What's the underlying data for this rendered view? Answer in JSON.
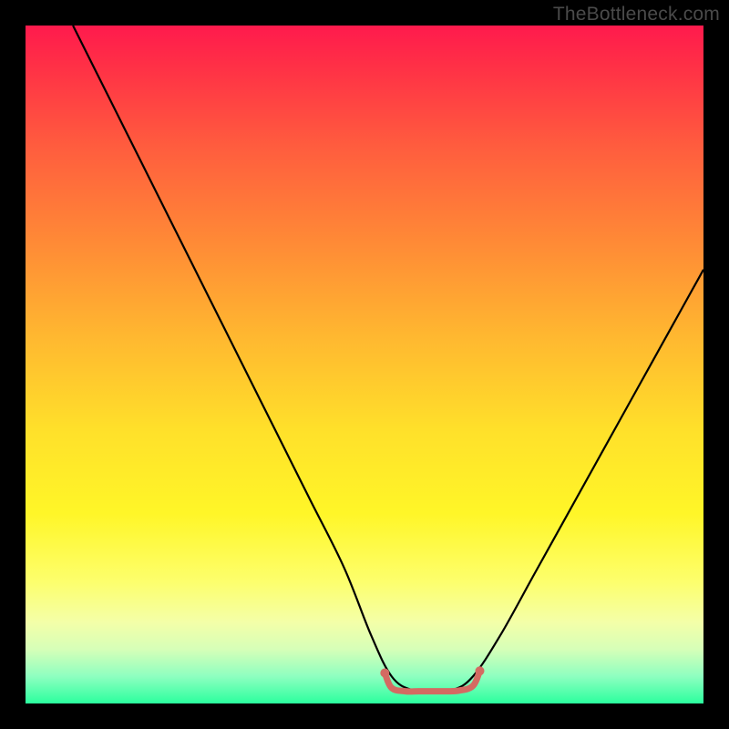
{
  "watermark": "TheBottleneck.com",
  "chart_data": {
    "type": "line",
    "title": "",
    "xlabel": "",
    "ylabel": "",
    "xlim": [
      0,
      100
    ],
    "ylim": [
      0,
      100
    ],
    "grid": false,
    "legend": false,
    "background_gradient": {
      "top": "#ff1a4d",
      "mid": "#ffe12a",
      "bottom": "#2bff9e"
    },
    "series": [
      {
        "name": "bottleneck-curve",
        "stroke": "#000000",
        "x": [
          7,
          12,
          17,
          22,
          27,
          32,
          37,
          42,
          47,
          51,
          54,
          57,
          60,
          63,
          66,
          70,
          75,
          80,
          85,
          90,
          95,
          100
        ],
        "y": [
          100,
          90,
          80,
          70,
          60,
          50,
          40,
          30,
          20,
          10,
          4,
          2,
          2,
          2,
          4,
          10,
          19,
          28,
          37,
          46,
          55,
          64
        ]
      },
      {
        "name": "valley-marker",
        "stroke": "#d46a62",
        "x": [
          53,
          54,
          56,
          58,
          60,
          62,
          64,
          66,
          67
        ],
        "y": [
          4.5,
          2.3,
          1.8,
          1.8,
          1.8,
          1.8,
          1.9,
          2.6,
          4.8
        ]
      }
    ]
  }
}
